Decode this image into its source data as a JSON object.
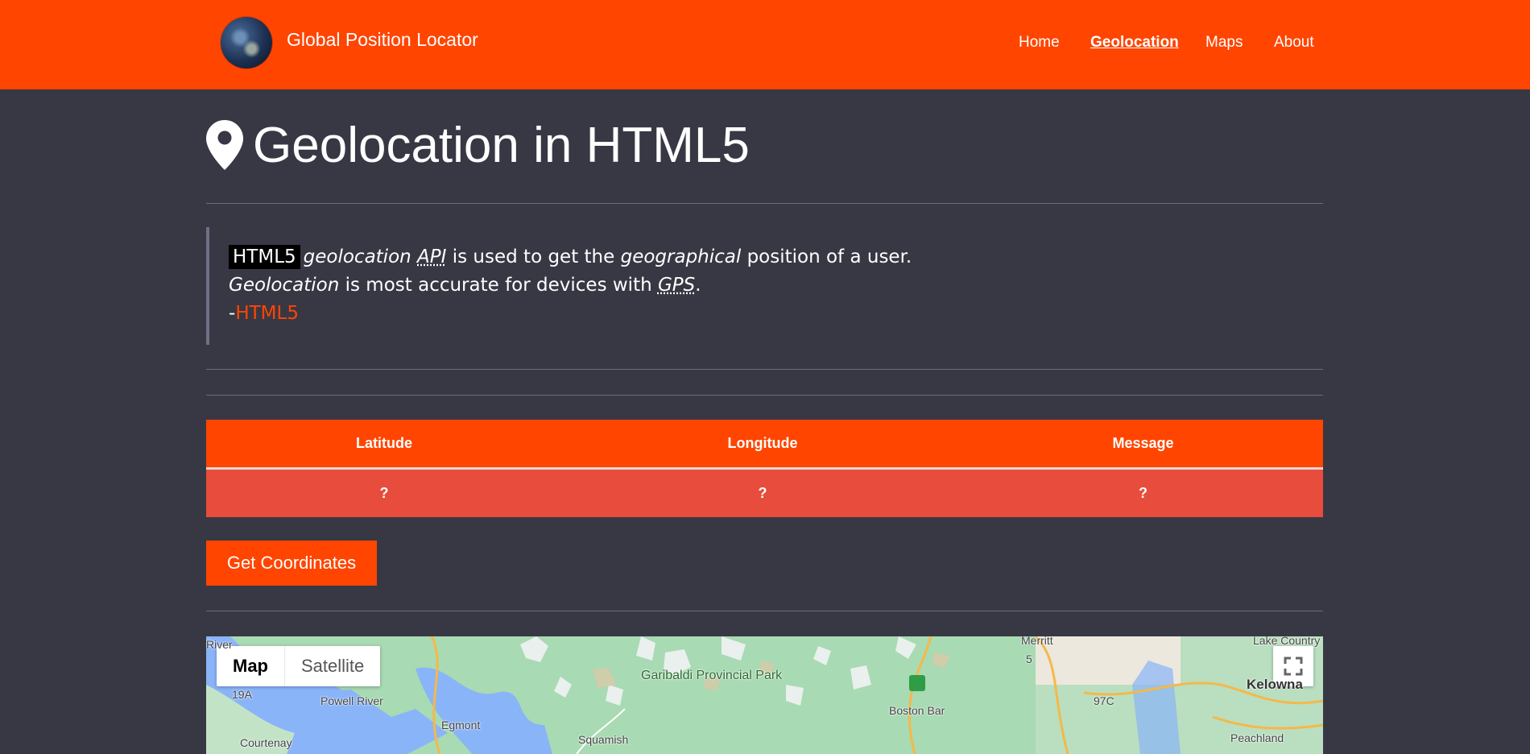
{
  "navbar": {
    "brand": "Global Position Locator",
    "links": [
      "Home",
      "Geolocation",
      "Maps",
      "About"
    ],
    "active": "Geolocation"
  },
  "page": {
    "title": "Geolocation in HTML5"
  },
  "quote": {
    "badge": "HTML5",
    "line1_em1": "geolocation",
    "line1_abbr": "API",
    "line1_mid": " is used to get the ",
    "line1_em2": "geographical",
    "line1_end": " position of a user.",
    "line2_em": "Geolocation",
    "line2_mid": " is most accurate for devices with ",
    "line2_abbr": "GPS",
    "line2_end": ".",
    "source_prefix": "-",
    "source_link": "HTML5"
  },
  "table": {
    "headers": [
      "Latitude",
      "Longitude",
      "Message"
    ],
    "values": [
      "?",
      "?",
      "?"
    ]
  },
  "button": {
    "label": "Get Coordinates"
  },
  "map": {
    "type_buttons": [
      "Map",
      "Satellite"
    ],
    "labels": {
      "merritt": "Merritt",
      "lake_country": "Lake Country",
      "powell_river": "Powell River",
      "egmont": "Egmont",
      "garibaldi": "Garibaldi Provincial Park",
      "boston_bar": "Boston Bar",
      "kelowna": "Kelowna",
      "peachland": "Peachland",
      "squamish": "Squamish",
      "courtenay": "Courtenay",
      "river": "River",
      "route_19a": "19A",
      "route_97c": "97C",
      "route_5": "5"
    }
  },
  "colors": {
    "accent": "#ff4500",
    "background": "#383844",
    "table_row": "#e74c3c"
  }
}
